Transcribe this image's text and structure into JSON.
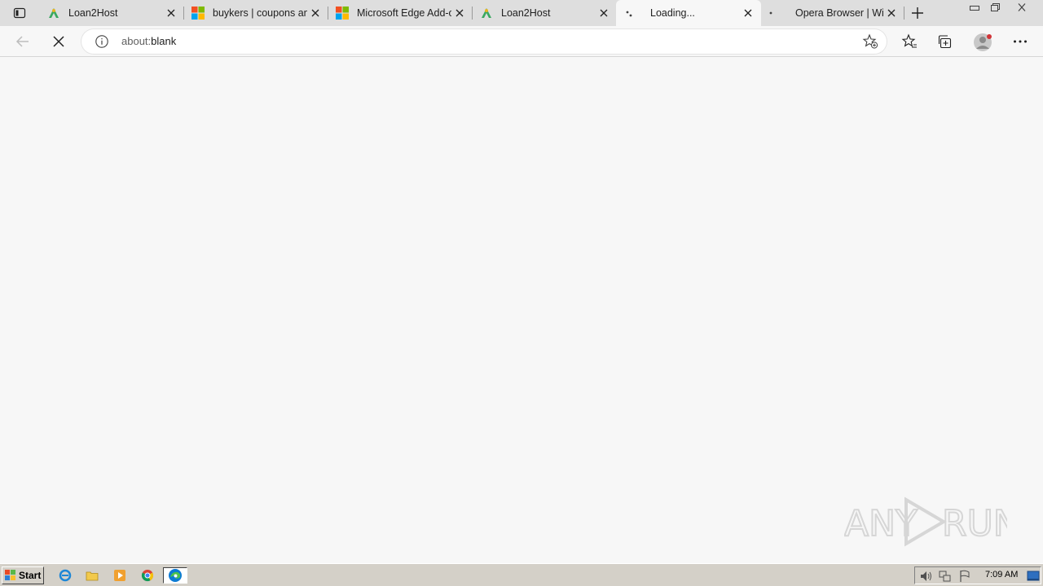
{
  "browser": {
    "tabs": [
      {
        "title": "Loan2Host",
        "favicon": "loan2host-icon",
        "active": false
      },
      {
        "title": "buykers | coupons and deals",
        "favicon": "microsoft-icon",
        "active": false
      },
      {
        "title": "Microsoft Edge Add-ons",
        "favicon": "microsoft-icon",
        "active": false
      },
      {
        "title": "Loan2Host",
        "favicon": "loan2host-icon",
        "active": false
      },
      {
        "title": "Loading...",
        "favicon": "loading-spinner-icon",
        "active": true
      },
      {
        "title": "Opera Browser | Windows",
        "favicon": "loading-spinner-icon",
        "active": false
      }
    ],
    "address": {
      "scheme": "about:",
      "rest": "blank"
    }
  },
  "watermark": {
    "text": "ANY RUN"
  },
  "taskbar": {
    "start_label": "Start",
    "clock": "7:09 AM"
  },
  "colors": {
    "tabstrip_bg": "#dedede",
    "page_bg": "#f7f7f7",
    "taskbar_bg": "#d4d0c8",
    "edge_blue": "#0c7bd4",
    "edge_green": "#4cc24a",
    "loan2host_green": "#3aa860"
  }
}
